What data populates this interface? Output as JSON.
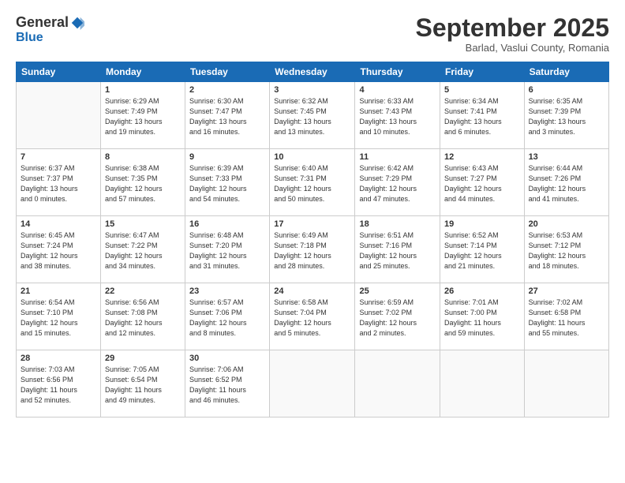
{
  "header": {
    "logo_general": "General",
    "logo_blue": "Blue",
    "month_title": "September 2025",
    "location": "Barlad, Vaslui County, Romania"
  },
  "days_of_week": [
    "Sunday",
    "Monday",
    "Tuesday",
    "Wednesday",
    "Thursday",
    "Friday",
    "Saturday"
  ],
  "weeks": [
    [
      {
        "day": "",
        "info": ""
      },
      {
        "day": "1",
        "info": "Sunrise: 6:29 AM\nSunset: 7:49 PM\nDaylight: 13 hours\nand 19 minutes."
      },
      {
        "day": "2",
        "info": "Sunrise: 6:30 AM\nSunset: 7:47 PM\nDaylight: 13 hours\nand 16 minutes."
      },
      {
        "day": "3",
        "info": "Sunrise: 6:32 AM\nSunset: 7:45 PM\nDaylight: 13 hours\nand 13 minutes."
      },
      {
        "day": "4",
        "info": "Sunrise: 6:33 AM\nSunset: 7:43 PM\nDaylight: 13 hours\nand 10 minutes."
      },
      {
        "day": "5",
        "info": "Sunrise: 6:34 AM\nSunset: 7:41 PM\nDaylight: 13 hours\nand 6 minutes."
      },
      {
        "day": "6",
        "info": "Sunrise: 6:35 AM\nSunset: 7:39 PM\nDaylight: 13 hours\nand 3 minutes."
      }
    ],
    [
      {
        "day": "7",
        "info": "Sunrise: 6:37 AM\nSunset: 7:37 PM\nDaylight: 13 hours\nand 0 minutes."
      },
      {
        "day": "8",
        "info": "Sunrise: 6:38 AM\nSunset: 7:35 PM\nDaylight: 12 hours\nand 57 minutes."
      },
      {
        "day": "9",
        "info": "Sunrise: 6:39 AM\nSunset: 7:33 PM\nDaylight: 12 hours\nand 54 minutes."
      },
      {
        "day": "10",
        "info": "Sunrise: 6:40 AM\nSunset: 7:31 PM\nDaylight: 12 hours\nand 50 minutes."
      },
      {
        "day": "11",
        "info": "Sunrise: 6:42 AM\nSunset: 7:29 PM\nDaylight: 12 hours\nand 47 minutes."
      },
      {
        "day": "12",
        "info": "Sunrise: 6:43 AM\nSunset: 7:27 PM\nDaylight: 12 hours\nand 44 minutes."
      },
      {
        "day": "13",
        "info": "Sunrise: 6:44 AM\nSunset: 7:26 PM\nDaylight: 12 hours\nand 41 minutes."
      }
    ],
    [
      {
        "day": "14",
        "info": "Sunrise: 6:45 AM\nSunset: 7:24 PM\nDaylight: 12 hours\nand 38 minutes."
      },
      {
        "day": "15",
        "info": "Sunrise: 6:47 AM\nSunset: 7:22 PM\nDaylight: 12 hours\nand 34 minutes."
      },
      {
        "day": "16",
        "info": "Sunrise: 6:48 AM\nSunset: 7:20 PM\nDaylight: 12 hours\nand 31 minutes."
      },
      {
        "day": "17",
        "info": "Sunrise: 6:49 AM\nSunset: 7:18 PM\nDaylight: 12 hours\nand 28 minutes."
      },
      {
        "day": "18",
        "info": "Sunrise: 6:51 AM\nSunset: 7:16 PM\nDaylight: 12 hours\nand 25 minutes."
      },
      {
        "day": "19",
        "info": "Sunrise: 6:52 AM\nSunset: 7:14 PM\nDaylight: 12 hours\nand 21 minutes."
      },
      {
        "day": "20",
        "info": "Sunrise: 6:53 AM\nSunset: 7:12 PM\nDaylight: 12 hours\nand 18 minutes."
      }
    ],
    [
      {
        "day": "21",
        "info": "Sunrise: 6:54 AM\nSunset: 7:10 PM\nDaylight: 12 hours\nand 15 minutes."
      },
      {
        "day": "22",
        "info": "Sunrise: 6:56 AM\nSunset: 7:08 PM\nDaylight: 12 hours\nand 12 minutes."
      },
      {
        "day": "23",
        "info": "Sunrise: 6:57 AM\nSunset: 7:06 PM\nDaylight: 12 hours\nand 8 minutes."
      },
      {
        "day": "24",
        "info": "Sunrise: 6:58 AM\nSunset: 7:04 PM\nDaylight: 12 hours\nand 5 minutes."
      },
      {
        "day": "25",
        "info": "Sunrise: 6:59 AM\nSunset: 7:02 PM\nDaylight: 12 hours\nand 2 minutes."
      },
      {
        "day": "26",
        "info": "Sunrise: 7:01 AM\nSunset: 7:00 PM\nDaylight: 11 hours\nand 59 minutes."
      },
      {
        "day": "27",
        "info": "Sunrise: 7:02 AM\nSunset: 6:58 PM\nDaylight: 11 hours\nand 55 minutes."
      }
    ],
    [
      {
        "day": "28",
        "info": "Sunrise: 7:03 AM\nSunset: 6:56 PM\nDaylight: 11 hours\nand 52 minutes."
      },
      {
        "day": "29",
        "info": "Sunrise: 7:05 AM\nSunset: 6:54 PM\nDaylight: 11 hours\nand 49 minutes."
      },
      {
        "day": "30",
        "info": "Sunrise: 7:06 AM\nSunset: 6:52 PM\nDaylight: 11 hours\nand 46 minutes."
      },
      {
        "day": "",
        "info": ""
      },
      {
        "day": "",
        "info": ""
      },
      {
        "day": "",
        "info": ""
      },
      {
        "day": "",
        "info": ""
      }
    ]
  ]
}
